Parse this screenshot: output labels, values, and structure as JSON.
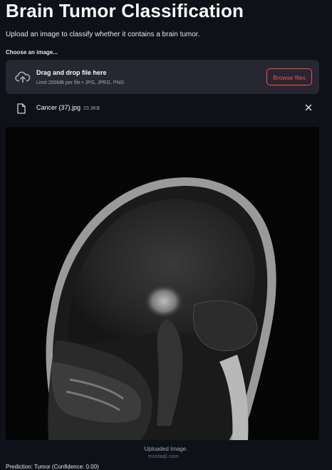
{
  "page": {
    "title": "Brain Tumor Classification",
    "subtitle": "Upload an image to classify whether it contains a brain tumor."
  },
  "uploader": {
    "label": "Choose an image...",
    "drop_title": "Drag and drop file here",
    "limit_text": "Limit 200MB per file • JPG, JPEG, PNG",
    "browse_label": "Browse files",
    "icon": "cloud-upload-icon"
  },
  "uploaded_file": {
    "name": "Cancer (37).jpg",
    "size": "23.3KB",
    "icon": "file-icon",
    "remove_icon": "close-icon"
  },
  "image": {
    "caption": "Uploaded Image.",
    "watermark": "mostaql.com"
  },
  "result": {
    "prediction_text": "Prediction: Tumor (Confidence: 0.00)"
  },
  "colors": {
    "background": "#0e1117",
    "panel": "#262730",
    "accent": "#ff4b4b",
    "muted_text": "#a3a8b8"
  }
}
